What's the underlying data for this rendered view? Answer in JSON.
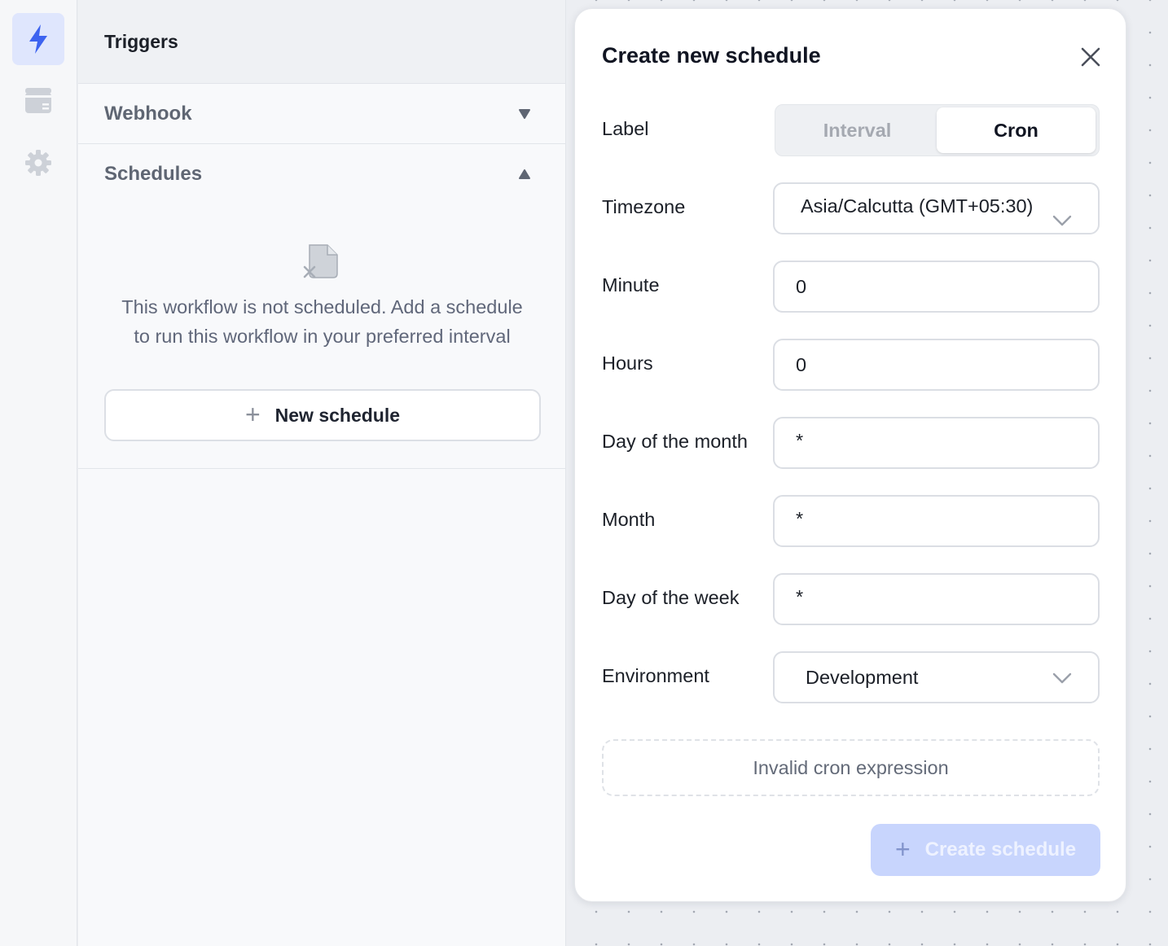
{
  "rail": {
    "items": [
      {
        "name": "triggers",
        "icon": "lightning-icon",
        "active": true
      },
      {
        "name": "storage",
        "icon": "wallet-icon",
        "active": false
      },
      {
        "name": "settings",
        "icon": "gear-icon",
        "active": false
      }
    ]
  },
  "panel": {
    "title": "Triggers",
    "webhook_label": "Webhook",
    "schedules_label": "Schedules",
    "empty_text_line1": "This workflow is not scheduled. Add a schedule",
    "empty_text_line2": "to run this workflow in your preferred interval",
    "new_schedule_label": "New schedule",
    "plus": "+"
  },
  "modal": {
    "title": "Create new schedule",
    "label_label": "Label",
    "tabs": {
      "interval": "Interval",
      "cron": "Cron",
      "selected": "Cron"
    },
    "timezone_label": "Timezone",
    "timezone_value": "Asia/Calcutta (GMT+05:30)",
    "minute_label": "Minute",
    "minute_value": "0",
    "hours_label": "Hours",
    "hours_value": "0",
    "dom_label": "Day of the month",
    "dom_value": "*",
    "month_label": "Month",
    "month_value": "*",
    "dow_label": "Day of the week",
    "dow_value": "*",
    "env_label": "Environment",
    "env_value": "Development",
    "validation_text": "Invalid cron expression",
    "create_label": "Create schedule",
    "plus": "+"
  },
  "colors": {
    "accent": "#3d63f0",
    "accent_bg": "#dfe6fd",
    "disabled_button": "#c8d5fd"
  }
}
